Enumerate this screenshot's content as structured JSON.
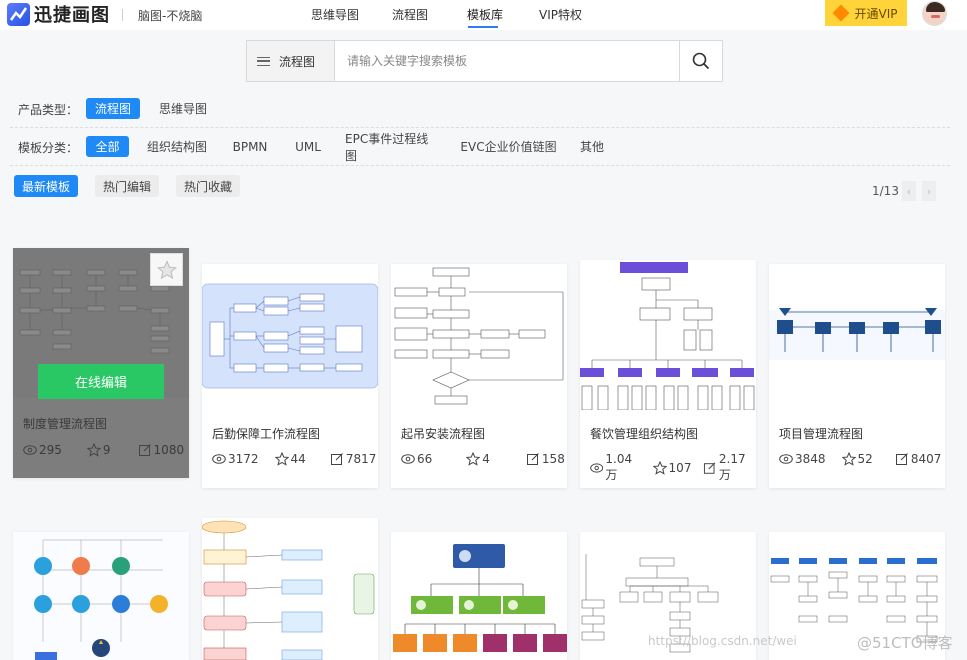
{
  "header": {
    "logo_text": "迅捷画图",
    "slogan": "脑图-不烧脑",
    "nav": [
      "思维导图",
      "流程图",
      "模板库",
      "VIP特权"
    ],
    "active_nav": "模板库",
    "vip_label": "开通VIP"
  },
  "search": {
    "type_label": "流程图",
    "placeholder": "请输入关键字搜索模板"
  },
  "filters": {
    "product_label": "产品类型：",
    "product_options": [
      "流程图",
      "思维导图"
    ],
    "category_label": "模板分类：",
    "category_options": [
      "全部",
      "组织结构图",
      "BPMN",
      "UML",
      "EPC事件过程线图",
      "EVC企业价值链图",
      "其他"
    ]
  },
  "sort": {
    "options": [
      "最新模板",
      "热门编辑",
      "热门收藏"
    ],
    "page": "1/13"
  },
  "cards": [
    {
      "title": "制度管理流程图",
      "views": "295",
      "likes": "9",
      "edits": "1080",
      "edit_label": "在线编辑"
    },
    {
      "title": "后勤保障工作流程图",
      "views": "3172",
      "likes": "44",
      "edits": "7817"
    },
    {
      "title": "起吊安装流程图",
      "views": "66",
      "likes": "4",
      "edits": "158"
    },
    {
      "title": "餐饮管理组织结构图",
      "views": "1.04万",
      "likes": "107",
      "edits": "2.17万"
    },
    {
      "title": "项目管理流程图",
      "views": "3848",
      "likes": "52",
      "edits": "8407"
    }
  ],
  "watermark": "https://blog.csdn.net/wei",
  "watermark_badge": "@51CTO博客",
  "colors": {
    "accent": "#1f89f5",
    "vip": "#ffd43a",
    "edit": "#2ac864"
  }
}
